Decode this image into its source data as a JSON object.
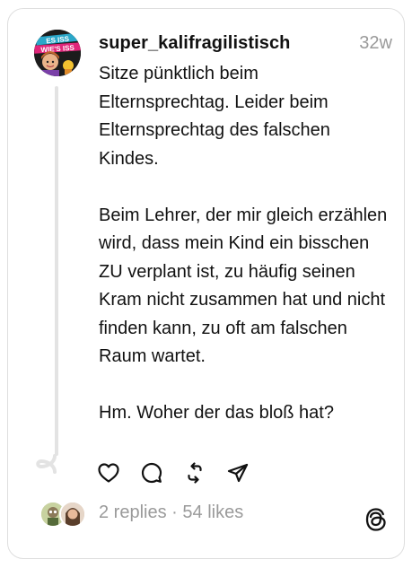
{
  "post": {
    "username": "super_kalifragilistisch",
    "timestamp": "32w",
    "avatar_text_top": "ES ISS",
    "avatar_text_bottom": "WIE'S ISS",
    "paragraphs": [
      "Sitze pünktlich beim Elternsprechtag. Leider beim Elternsprechtag des falschen Kindes.",
      "Beim Lehrer, der mir gleich erzählen wird, dass mein Kind ein bisschen ZU verplant ist, zu häufig seinen Kram nicht zusammen hat und nicht finden kann, zu oft am falschen Raum wartet.",
      "Hm. Woher der das bloß hat?"
    ]
  },
  "actions": {
    "like_icon": "heart-icon",
    "reply_icon": "comment-icon",
    "repost_icon": "repost-icon",
    "share_icon": "send-icon"
  },
  "footer": {
    "replies": "2 replies",
    "separator": " · ",
    "likes": "54 likes",
    "logo_icon": "threads-logo-icon"
  },
  "colors": {
    "text": "#111111",
    "muted": "#9a9a9a",
    "border": "#dedede",
    "thread_line": "#e3e3e3"
  }
}
